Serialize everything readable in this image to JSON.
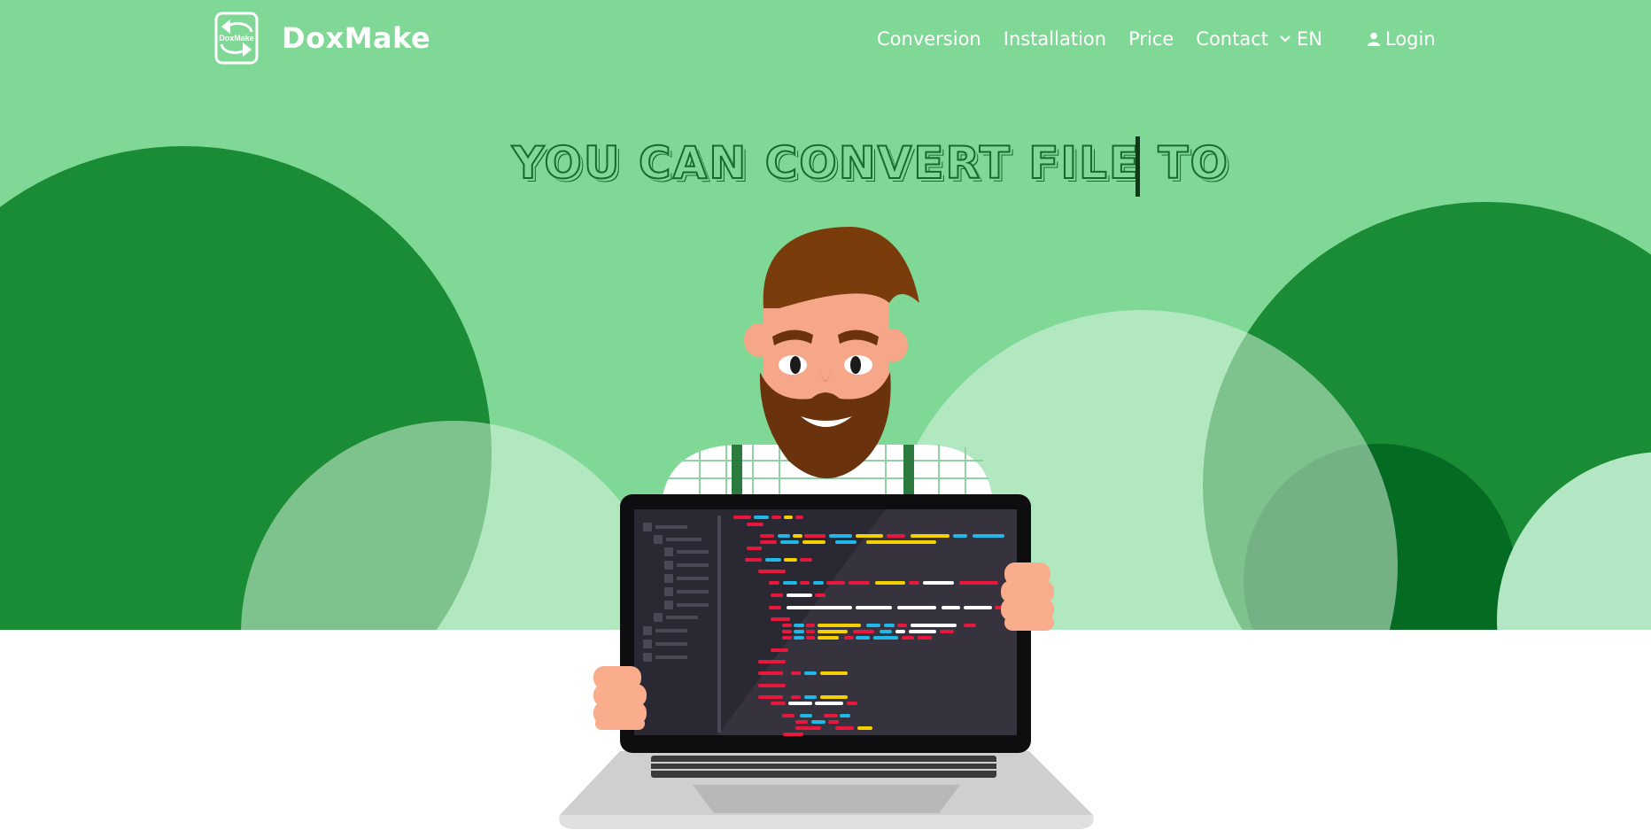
{
  "brand": {
    "name": "DoxMake",
    "logo_text": "DoxMake"
  },
  "nav": {
    "items": [
      {
        "label": "Conversion"
      },
      {
        "label": "Installation"
      },
      {
        "label": "Price"
      },
      {
        "label": "Contact"
      }
    ],
    "language": "EN",
    "login": "Login"
  },
  "hero": {
    "headline": "YOU CAN CONVERT FILE TO"
  },
  "icons": {
    "language": "chevron-down-icon",
    "login": "user-icon"
  },
  "colors": {
    "hero_bg": "#80d896",
    "dark_green": "#1a8c35",
    "darker_green": "#066b22",
    "light_green": "#b3e7c3",
    "white": "#ffffff"
  }
}
